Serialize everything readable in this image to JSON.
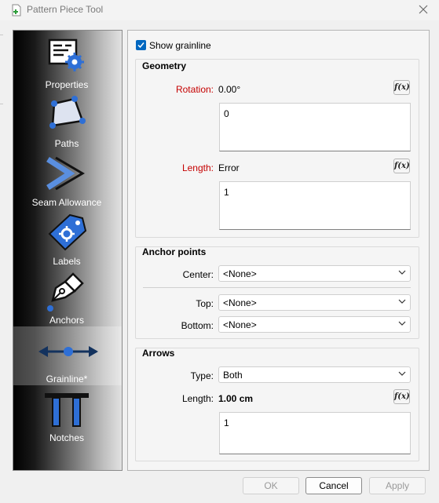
{
  "window": {
    "title": "Pattern Piece Tool"
  },
  "sidebar": {
    "items": [
      {
        "label": "Properties",
        "icon": "properties-icon"
      },
      {
        "label": "Paths",
        "icon": "paths-icon"
      },
      {
        "label": "Seam Allowance",
        "icon": "seam-allowance-icon"
      },
      {
        "label": "Labels",
        "icon": "labels-icon"
      },
      {
        "label": "Anchors",
        "icon": "anchors-icon"
      },
      {
        "label": "Grainline*",
        "icon": "grainline-icon",
        "selected": true
      },
      {
        "label": "Notches",
        "icon": "notches-icon"
      }
    ]
  },
  "grainline": {
    "show_label": "Show grainline",
    "show_checked": true,
    "geometry": {
      "title": "Geometry",
      "rotation_label": "Rotation:",
      "rotation_value": "0.00°",
      "rotation_formula": "0",
      "length_label": "Length:",
      "length_value": "Error",
      "length_formula": "1"
    },
    "anchor_points": {
      "title": "Anchor points",
      "center_label": "Center:",
      "center_value": "<None>",
      "top_label": "Top:",
      "top_value": "<None>",
      "bottom_label": "Bottom:",
      "bottom_value": "<None>"
    },
    "arrows": {
      "title": "Arrows",
      "type_label": "Type:",
      "type_value": "Both",
      "length_label": "Length:",
      "length_value": "1.00 cm",
      "length_formula": "1"
    },
    "formula_button": "f(x)"
  },
  "buttons": {
    "ok": "OK",
    "cancel": "Cancel",
    "apply": "Apply"
  },
  "colors": {
    "accent": "#0067c0",
    "error_label": "#c50000",
    "icon_blue": "#2e6fd6"
  }
}
